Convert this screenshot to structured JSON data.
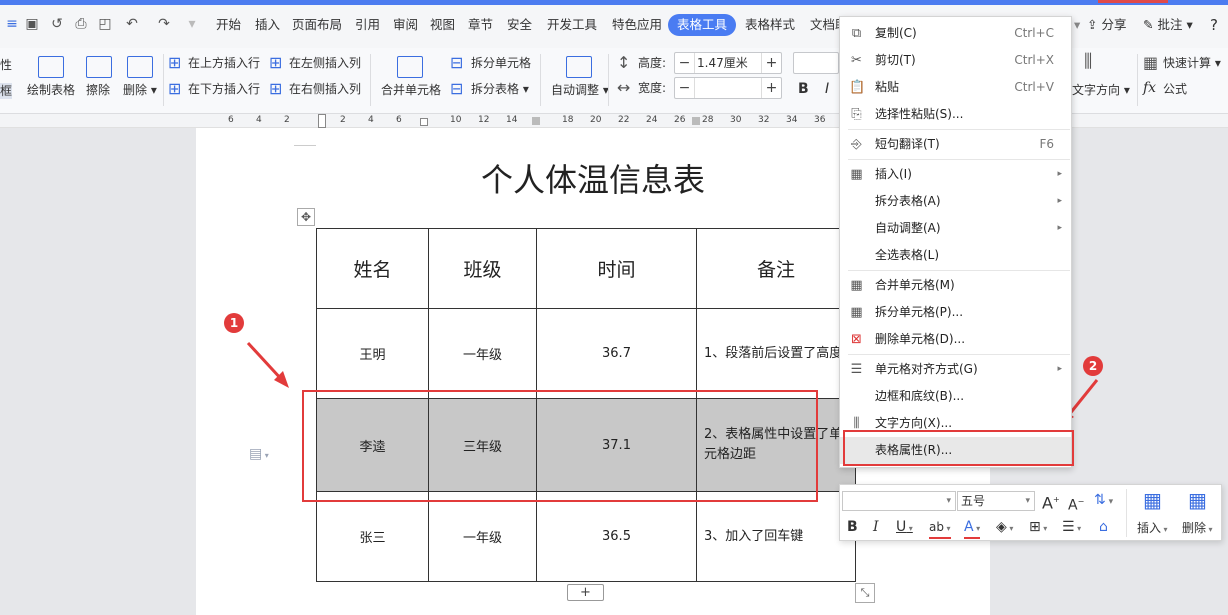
{
  "quick_access": [
    "save-icon",
    "redo-draw-icon",
    "print-icon",
    "print-preview-icon",
    "undo-icon",
    "redo-icon"
  ],
  "tabs": [
    "开始",
    "插入",
    "页面布局",
    "引用",
    "审阅",
    "视图",
    "章节",
    "安全",
    "开发工具",
    "特色应用",
    "表格工具",
    "表格样式",
    "文档助"
  ],
  "active_tab": "表格工具",
  "right_tools": {
    "share": "分享",
    "comment": "批注",
    "help": "?"
  },
  "ribbon": {
    "left_edge": [
      "性",
      "框"
    ],
    "draw_table": "绘制表格",
    "erase": "擦除",
    "delete": "删除",
    "insert_above": "在上方插入行",
    "insert_below": "在下方插入行",
    "insert_left": "在左侧插入列",
    "insert_right": "在右侧插入列",
    "merge_cells": "合并单元格",
    "split_cells": "拆分单元格",
    "split_table": "拆分表格",
    "auto_adjust": "自动调整",
    "height_label": "高度:",
    "height_value": "1.47厘米",
    "width_label": "宽度:",
    "width_value": "",
    "bold": "B",
    "italic": "I",
    "text_direction": "文字方向",
    "quick_calc": "快速计算",
    "formula": "公式"
  },
  "ruler": [
    "6",
    "4",
    "2",
    "2",
    "4",
    "6",
    "10",
    "12",
    "14",
    "18",
    "20",
    "22",
    "24",
    "26",
    "28",
    "30",
    "32",
    "34",
    "36"
  ],
  "document": {
    "title": "个人体温信息表",
    "table": {
      "headers": [
        "姓名",
        "班级",
        "时间",
        "备注"
      ],
      "rows": [
        [
          "王明",
          "一年级",
          "36.7",
          "1、段落前后设置了高度"
        ],
        [
          "李逵",
          "三年级",
          "37.1",
          "2、表格属性中设置了单元格边距"
        ],
        [
          "张三",
          "一年级",
          "36.5",
          "3、加入了回车键"
        ]
      ]
    },
    "add_row_symbol": "+"
  },
  "annotations": [
    "1",
    "2"
  ],
  "context_menu": [
    {
      "label": "复制(C)",
      "shortcut": "Ctrl+C",
      "icon": "copy-icon"
    },
    {
      "label": "剪切(T)",
      "shortcut": "Ctrl+X",
      "icon": "cut-icon"
    },
    {
      "label": "粘贴",
      "shortcut": "Ctrl+V",
      "icon": "paste-icon"
    },
    {
      "label": "选择性粘贴(S)...",
      "shortcut": "",
      "icon": "paste-special-icon"
    },
    {
      "label": "短句翻译(T)",
      "shortcut": "F6",
      "icon": "translate-icon"
    },
    {
      "label": "插入(I)",
      "shortcut": "",
      "icon": "insert-table-icon",
      "submenu": true
    },
    {
      "label": "拆分表格(A)",
      "shortcut": "",
      "icon": "",
      "submenu": true
    },
    {
      "label": "自动调整(A)",
      "shortcut": "",
      "icon": "",
      "submenu": true
    },
    {
      "label": "全选表格(L)",
      "shortcut": "",
      "icon": ""
    },
    {
      "label": "合并单元格(M)",
      "shortcut": "",
      "icon": "merge-cells-icon"
    },
    {
      "label": "拆分单元格(P)...",
      "shortcut": "",
      "icon": "split-cells-icon"
    },
    {
      "label": "删除单元格(D)...",
      "shortcut": "",
      "icon": "delete-cells-icon"
    },
    {
      "label": "单元格对齐方式(G)",
      "shortcut": "",
      "icon": "cell-align-icon",
      "submenu": true
    },
    {
      "label": "边框和底纹(B)...",
      "shortcut": "",
      "icon": ""
    },
    {
      "label": "文字方向(X)...",
      "shortcut": "",
      "icon": "text-direction-icon"
    },
    {
      "label": "表格属性(R)...",
      "shortcut": "",
      "icon": "",
      "highlighted": true
    }
  ],
  "mini_toolbar": {
    "font_name": "",
    "font_size": "五号",
    "bold": "B",
    "italic": "I",
    "underline": "U",
    "highlight": "ab",
    "font_color": "A",
    "insert": "插入",
    "delete": "删除"
  },
  "colors": {
    "accent": "#4a7cf2",
    "annotation": "#e23b3b",
    "selected_row": "#c8c8c8"
  }
}
